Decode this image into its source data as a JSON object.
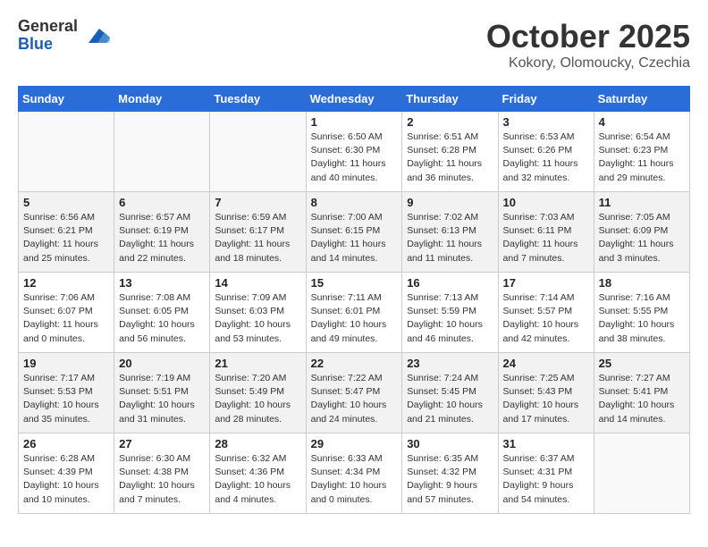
{
  "header": {
    "logo_general": "General",
    "logo_blue": "Blue",
    "title": "October 2025",
    "location": "Kokory, Olomoucky, Czechia"
  },
  "days_of_week": [
    "Sunday",
    "Monday",
    "Tuesday",
    "Wednesday",
    "Thursday",
    "Friday",
    "Saturday"
  ],
  "weeks": [
    [
      {
        "day": "",
        "info": ""
      },
      {
        "day": "",
        "info": ""
      },
      {
        "day": "",
        "info": ""
      },
      {
        "day": "1",
        "info": "Sunrise: 6:50 AM\nSunset: 6:30 PM\nDaylight: 11 hours\nand 40 minutes."
      },
      {
        "day": "2",
        "info": "Sunrise: 6:51 AM\nSunset: 6:28 PM\nDaylight: 11 hours\nand 36 minutes."
      },
      {
        "day": "3",
        "info": "Sunrise: 6:53 AM\nSunset: 6:26 PM\nDaylight: 11 hours\nand 32 minutes."
      },
      {
        "day": "4",
        "info": "Sunrise: 6:54 AM\nSunset: 6:23 PM\nDaylight: 11 hours\nand 29 minutes."
      }
    ],
    [
      {
        "day": "5",
        "info": "Sunrise: 6:56 AM\nSunset: 6:21 PM\nDaylight: 11 hours\nand 25 minutes."
      },
      {
        "day": "6",
        "info": "Sunrise: 6:57 AM\nSunset: 6:19 PM\nDaylight: 11 hours\nand 22 minutes."
      },
      {
        "day": "7",
        "info": "Sunrise: 6:59 AM\nSunset: 6:17 PM\nDaylight: 11 hours\nand 18 minutes."
      },
      {
        "day": "8",
        "info": "Sunrise: 7:00 AM\nSunset: 6:15 PM\nDaylight: 11 hours\nand 14 minutes."
      },
      {
        "day": "9",
        "info": "Sunrise: 7:02 AM\nSunset: 6:13 PM\nDaylight: 11 hours\nand 11 minutes."
      },
      {
        "day": "10",
        "info": "Sunrise: 7:03 AM\nSunset: 6:11 PM\nDaylight: 11 hours\nand 7 minutes."
      },
      {
        "day": "11",
        "info": "Sunrise: 7:05 AM\nSunset: 6:09 PM\nDaylight: 11 hours\nand 3 minutes."
      }
    ],
    [
      {
        "day": "12",
        "info": "Sunrise: 7:06 AM\nSunset: 6:07 PM\nDaylight: 11 hours\nand 0 minutes."
      },
      {
        "day": "13",
        "info": "Sunrise: 7:08 AM\nSunset: 6:05 PM\nDaylight: 10 hours\nand 56 minutes."
      },
      {
        "day": "14",
        "info": "Sunrise: 7:09 AM\nSunset: 6:03 PM\nDaylight: 10 hours\nand 53 minutes."
      },
      {
        "day": "15",
        "info": "Sunrise: 7:11 AM\nSunset: 6:01 PM\nDaylight: 10 hours\nand 49 minutes."
      },
      {
        "day": "16",
        "info": "Sunrise: 7:13 AM\nSunset: 5:59 PM\nDaylight: 10 hours\nand 46 minutes."
      },
      {
        "day": "17",
        "info": "Sunrise: 7:14 AM\nSunset: 5:57 PM\nDaylight: 10 hours\nand 42 minutes."
      },
      {
        "day": "18",
        "info": "Sunrise: 7:16 AM\nSunset: 5:55 PM\nDaylight: 10 hours\nand 38 minutes."
      }
    ],
    [
      {
        "day": "19",
        "info": "Sunrise: 7:17 AM\nSunset: 5:53 PM\nDaylight: 10 hours\nand 35 minutes."
      },
      {
        "day": "20",
        "info": "Sunrise: 7:19 AM\nSunset: 5:51 PM\nDaylight: 10 hours\nand 31 minutes."
      },
      {
        "day": "21",
        "info": "Sunrise: 7:20 AM\nSunset: 5:49 PM\nDaylight: 10 hours\nand 28 minutes."
      },
      {
        "day": "22",
        "info": "Sunrise: 7:22 AM\nSunset: 5:47 PM\nDaylight: 10 hours\nand 24 minutes."
      },
      {
        "day": "23",
        "info": "Sunrise: 7:24 AM\nSunset: 5:45 PM\nDaylight: 10 hours\nand 21 minutes."
      },
      {
        "day": "24",
        "info": "Sunrise: 7:25 AM\nSunset: 5:43 PM\nDaylight: 10 hours\nand 17 minutes."
      },
      {
        "day": "25",
        "info": "Sunrise: 7:27 AM\nSunset: 5:41 PM\nDaylight: 10 hours\nand 14 minutes."
      }
    ],
    [
      {
        "day": "26",
        "info": "Sunrise: 6:28 AM\nSunset: 4:39 PM\nDaylight: 10 hours\nand 10 minutes."
      },
      {
        "day": "27",
        "info": "Sunrise: 6:30 AM\nSunset: 4:38 PM\nDaylight: 10 hours\nand 7 minutes."
      },
      {
        "day": "28",
        "info": "Sunrise: 6:32 AM\nSunset: 4:36 PM\nDaylight: 10 hours\nand 4 minutes."
      },
      {
        "day": "29",
        "info": "Sunrise: 6:33 AM\nSunset: 4:34 PM\nDaylight: 10 hours\nand 0 minutes."
      },
      {
        "day": "30",
        "info": "Sunrise: 6:35 AM\nSunset: 4:32 PM\nDaylight: 9 hours\nand 57 minutes."
      },
      {
        "day": "31",
        "info": "Sunrise: 6:37 AM\nSunset: 4:31 PM\nDaylight: 9 hours\nand 54 minutes."
      },
      {
        "day": "",
        "info": ""
      }
    ]
  ]
}
